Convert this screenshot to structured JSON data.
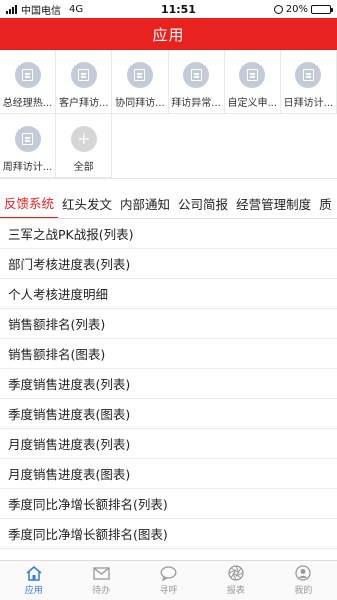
{
  "status": {
    "carrier": "中国电信",
    "network": "4G",
    "time": "11:51",
    "battery": "20%",
    "battery_level": 0.2
  },
  "header": {
    "title": "应用"
  },
  "apps": [
    {
      "label": "总经理热...",
      "icon": "doc-icon"
    },
    {
      "label": "客户拜访...",
      "icon": "doc-icon"
    },
    {
      "label": "协同拜访...",
      "icon": "doc-icon"
    },
    {
      "label": "拜访异常...",
      "icon": "doc-icon"
    },
    {
      "label": "自定义申...",
      "icon": "doc-icon"
    },
    {
      "label": "日拜访计...",
      "icon": "doc-icon"
    },
    {
      "label": "周拜访计...",
      "icon": "doc-icon"
    },
    {
      "label": "全部",
      "icon": "plus-icon"
    }
  ],
  "tabs": [
    "反馈系统",
    "红头发文",
    "内部通知",
    "公司简报",
    "经营管理制度",
    "质"
  ],
  "list": [
    "三军之战PK战报(列表)",
    "部门考核进度表(列表)",
    "个人考核进度明细",
    "销售额排名(列表)",
    "销售额排名(图表)",
    "季度销售进度表(列表)",
    "季度销售进度表(图表)",
    "月度销售进度表(列表)",
    "月度销售进度表(图表)",
    "季度同比净增长额排名(列表)",
    "季度同比净增长额排名(图表)"
  ],
  "nav": [
    {
      "label": "应用",
      "icon": "home-icon",
      "active": true
    },
    {
      "label": "待办",
      "icon": "mail-icon",
      "active": false
    },
    {
      "label": "寻呼",
      "icon": "chat-icon",
      "active": false
    },
    {
      "label": "报表",
      "icon": "aperture-icon",
      "active": false
    },
    {
      "label": "我的",
      "icon": "user-icon",
      "active": false
    }
  ],
  "colors": {
    "brand": "#e8231f",
    "nav_active": "#3a7bd5",
    "icon_bg": "#c3cbd8"
  }
}
